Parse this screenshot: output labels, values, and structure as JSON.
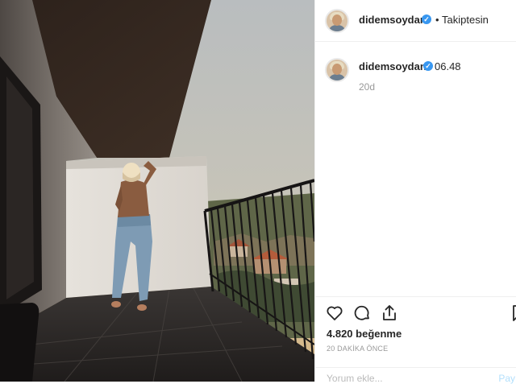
{
  "post": {
    "username": "didemsoydan",
    "verified": true,
    "follow_separator": "•",
    "follow_label": "Takiptesin",
    "caption_text": "06.48",
    "age": "20d",
    "likes": "4.820 beğenme",
    "posted": "20 DAKİKA ÖNCE",
    "comment_placeholder": "Yorum ekle...",
    "post_button": "Pay"
  },
  "icons": {
    "verified": "verified-badge-icon",
    "like": "heart-icon",
    "comment": "comment-icon",
    "share": "share-icon",
    "save": "bookmark-icon"
  },
  "colors": {
    "text": "#262626",
    "muted": "#999999",
    "verified": "#3897f0",
    "border": "#efefef"
  }
}
